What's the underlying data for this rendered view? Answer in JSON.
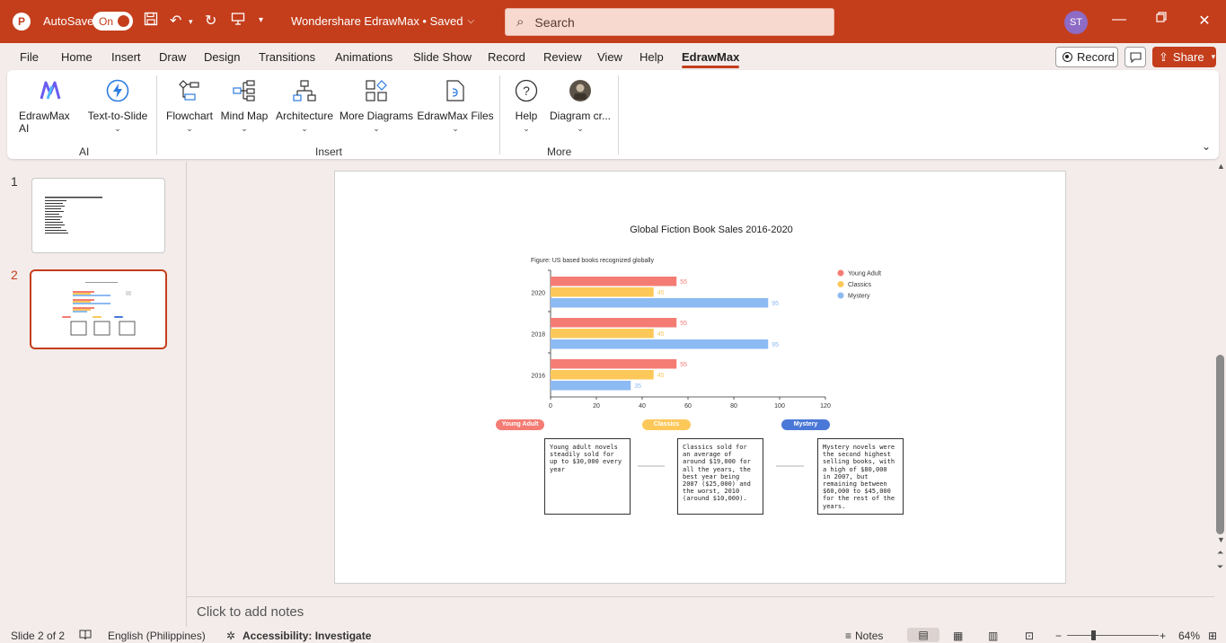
{
  "titlebar": {
    "autosave_label": "AutoSave",
    "autosave_state": "On",
    "doc_title": "Wondershare EdrawMax • Saved",
    "search_placeholder": "Search",
    "avatar_initials": "ST",
    "accent_color": "#c43e1c"
  },
  "menu": {
    "tabs": [
      "File",
      "Home",
      "Insert",
      "Draw",
      "Design",
      "Transitions",
      "Animations",
      "Slide Show",
      "Record",
      "Review",
      "View",
      "Help",
      "EdrawMax"
    ],
    "active_tab": "EdrawMax",
    "record_label": "Record",
    "share_label": "Share"
  },
  "ribbon": {
    "ai": {
      "label": "AI",
      "buttons": [
        {
          "label": "EdrawMax AI",
          "icon": "edrawmax-ai-icon"
        },
        {
          "label": "Text-to-Slide",
          "icon": "lightning-icon"
        }
      ]
    },
    "insert": {
      "label": "Insert",
      "buttons": [
        {
          "label": "Flowchart",
          "icon": "flowchart-icon"
        },
        {
          "label": "Mind Map",
          "icon": "mind-map-icon"
        },
        {
          "label": "Architecture",
          "icon": "architecture-icon"
        },
        {
          "label": "More Diagrams",
          "icon": "more-diagrams-icon"
        },
        {
          "label": "EdrawMax Files",
          "icon": "edrawmax-files-icon"
        }
      ]
    },
    "more": {
      "label": "More",
      "buttons": [
        {
          "label": "Help",
          "icon": "help-icon"
        },
        {
          "label": "Diagram cr...",
          "icon": "diagram-creator-icon"
        }
      ]
    }
  },
  "thumbnails": {
    "slides": [
      "1",
      "2"
    ],
    "selected": "2"
  },
  "slide": {
    "chart_data": {
      "type": "bar",
      "orientation": "horizontal",
      "title": "Global Fiction Book Sales 2016-2020",
      "subtitle": "Figure: US based books recognized globally",
      "categories": [
        "2020",
        "2018",
        "2016"
      ],
      "series": [
        {
          "name": "Young Adult",
          "values": [
            55,
            55,
            55
          ],
          "color": "#f47c74"
        },
        {
          "name": "Classics",
          "values": [
            45,
            45,
            45
          ],
          "color": "#fdc85a"
        },
        {
          "name": "Mystery",
          "values": [
            95,
            95,
            35
          ],
          "color": "#8cbaf2"
        }
      ],
      "xlim": [
        0,
        120
      ],
      "xticks": [
        "0",
        "20",
        "40",
        "60",
        "80",
        "100",
        "120"
      ],
      "legend": "top-right",
      "grid": false
    },
    "cards": [
      {
        "tag": "Young Adult",
        "color": "#f47c74",
        "text": "Young adult novels steadily sold for up to $30,000 every year"
      },
      {
        "tag": "Classics",
        "color": "#fdc85a",
        "text": "Classics sold for an average of around $19,000 for all the years, the best year being 2007 ($25,000) and the worst, 2010 (around $10,000)."
      },
      {
        "tag": "Mystery",
        "color": "#4a78d8",
        "text": "Mystery novels were the second highest selling books, with a high of $80,000 in 2007, but remaining between $60,000 to $45,000 for the rest of the years."
      }
    ]
  },
  "notes": {
    "placeholder": "Click to add notes"
  },
  "status": {
    "slide_info": "Slide 2 of 2",
    "language": "English (Philippines)",
    "accessibility": "Accessibility: Investigate",
    "notes_label": "Notes",
    "zoom": "64%"
  }
}
